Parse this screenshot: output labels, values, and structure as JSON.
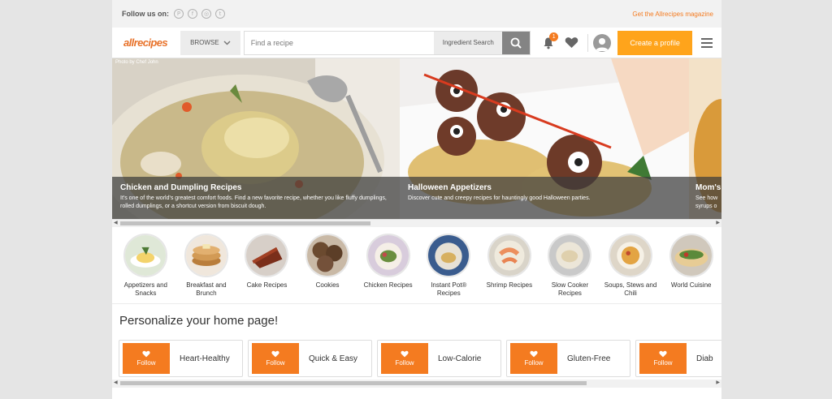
{
  "topbar": {
    "follow_label": "Follow us on:",
    "social": [
      {
        "icon": "pinterest-icon",
        "glyph": "P"
      },
      {
        "icon": "facebook-icon",
        "glyph": "f"
      },
      {
        "icon": "instagram-icon",
        "glyph": "◎"
      },
      {
        "icon": "twitter-icon",
        "glyph": "t"
      }
    ],
    "magazine_link": "Get the Allrecipes magazine"
  },
  "header": {
    "logo": "allrecipes",
    "browse_label": "BROWSE",
    "search_placeholder": "Find a recipe",
    "ingredient_search_label": "Ingredient Search",
    "notification_count": "1",
    "create_profile_label": "Create a profile",
    "accent_color": "#ffa41b"
  },
  "carousel": {
    "photo_credit": "Photo by Chef John",
    "slides": [
      {
        "title": "Chicken and Dumpling Recipes",
        "description": "It's one of the world's greatest comfort foods. Find a new favorite recipe, whether you like fluffy dumplings, rolled dumplings, or a shortcut version from biscuit dough."
      },
      {
        "title": "Halloween Appetizers",
        "description": "Discover cute and creepy recipes for hauntingly good Halloween parties."
      },
      {
        "title": "Mom's",
        "description": "See how syrups o"
      }
    ]
  },
  "categories": [
    {
      "label": "Appetizers and Snacks"
    },
    {
      "label": "Breakfast and Brunch"
    },
    {
      "label": "Cake Recipes"
    },
    {
      "label": "Cookies"
    },
    {
      "label": "Chicken Recipes"
    },
    {
      "label": "Instant Pot® Recipes"
    },
    {
      "label": "Shrimp Recipes"
    },
    {
      "label": "Slow Cooker Recipes"
    },
    {
      "label": "Soups, Stews and Chili"
    },
    {
      "label": "World Cuisine"
    }
  ],
  "personalize": {
    "title": "Personalize your home page!",
    "follow_label": "Follow",
    "tags": [
      {
        "label": "Heart-Healthy"
      },
      {
        "label": "Quick & Easy"
      },
      {
        "label": "Low-Calorie"
      },
      {
        "label": "Gluten-Free"
      },
      {
        "label": "Diab"
      }
    ]
  }
}
